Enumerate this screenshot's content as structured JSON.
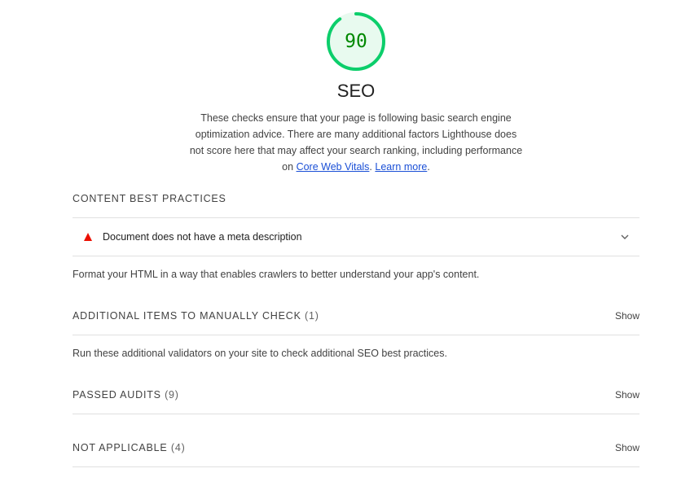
{
  "score": {
    "value": "90",
    "fraction": 0.9,
    "color": "#0cce6b",
    "text_color": "#008800",
    "bg_color": "#e8faef"
  },
  "category": {
    "title": "SEO",
    "description_text": "These checks ensure that your page is following basic search engine optimization advice. There are many additional factors Lighthouse does not score here that may affect your search ranking, including performance on",
    "link_cwv": "Core Web Vitals",
    "separator": ".",
    "link_learn": "Learn more",
    "end_period": "."
  },
  "groups": {
    "content": {
      "title": "CONTENT BEST PRACTICES",
      "audit": {
        "icon": "fail-triangle-icon",
        "title": "Document does not have a meta description"
      },
      "description": "Format your HTML in a way that enables crawlers to better understand your app's content."
    },
    "manual": {
      "title": "ADDITIONAL ITEMS TO MANUALLY CHECK",
      "count": "(1)",
      "toggle": "Show",
      "description": "Run these additional validators on your site to check additional SEO best practices."
    },
    "passed": {
      "title": "PASSED AUDITS",
      "count": "(9)",
      "toggle": "Show"
    },
    "notapplicable": {
      "title": "NOT APPLICABLE",
      "count": "(4)",
      "toggle": "Show"
    }
  },
  "colors": {
    "fail": "#eb0f00",
    "link": "#1a4fd6",
    "divider": "#e0e0e0"
  }
}
